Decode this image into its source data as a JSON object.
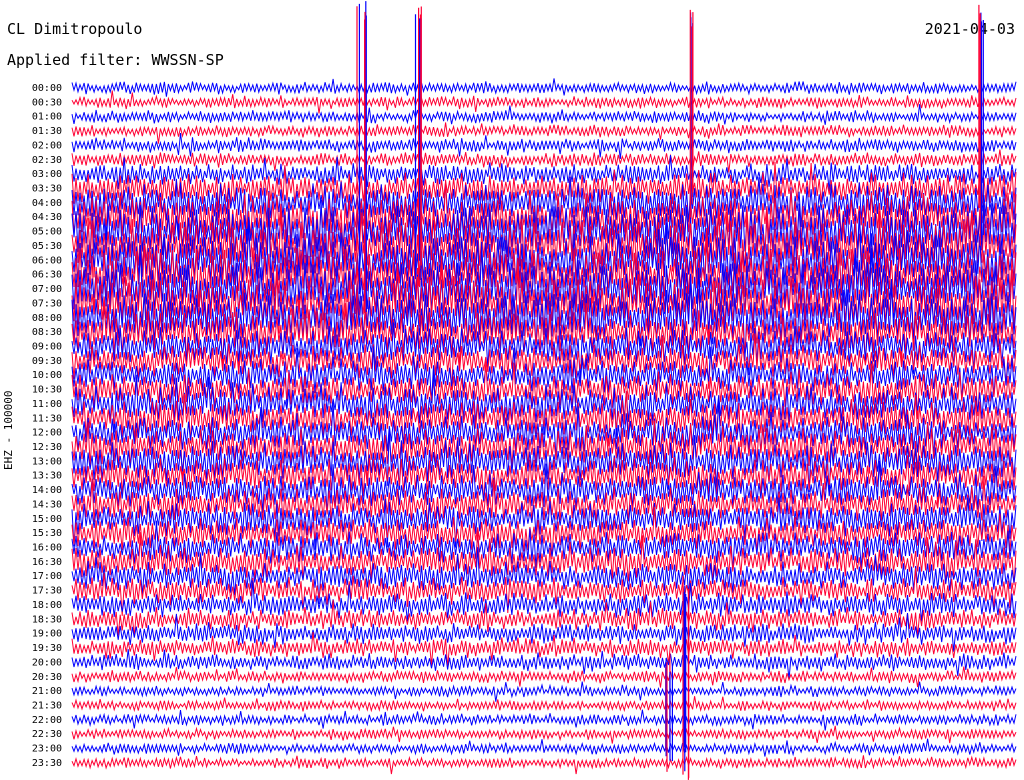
{
  "header": {
    "station": "CL Dimitropoulo",
    "filter": "Applied filter: WWSSN-SP",
    "date": "2021-04-03"
  },
  "channel_label": "EHZ - 100000",
  "chart_data": {
    "type": "line",
    "title": "CL Dimitropoulo",
    "subtitle": "Applied filter: WWSSN-SP",
    "date": "2021-04-03",
    "ylabel": "EHZ - 100000",
    "row_labels": [
      "00:00",
      "00:30",
      "01:00",
      "01:30",
      "02:00",
      "02:30",
      "03:00",
      "03:30",
      "04:00",
      "04:30",
      "05:00",
      "05:30",
      "06:00",
      "06:30",
      "07:00",
      "07:30",
      "08:00",
      "08:30",
      "09:00",
      "09:30",
      "10:00",
      "10:30",
      "11:00",
      "11:30",
      "12:00",
      "12:30",
      "13:00",
      "13:30",
      "14:00",
      "14:30",
      "15:00",
      "15:30",
      "16:00",
      "16:30",
      "17:00",
      "17:30",
      "18:00",
      "18:30",
      "19:00",
      "19:30",
      "20:00",
      "20:30",
      "21:00",
      "21:30",
      "22:00",
      "22:30",
      "23:00",
      "23:30"
    ],
    "row_amplitude": [
      0.15,
      0.15,
      0.15,
      0.15,
      0.2,
      0.2,
      0.35,
      0.55,
      0.75,
      0.9,
      1.0,
      1.0,
      1.0,
      1.0,
      1.0,
      1.0,
      1.0,
      0.8,
      0.65,
      0.6,
      0.6,
      0.6,
      0.65,
      0.65,
      0.65,
      0.7,
      0.7,
      0.65,
      0.6,
      0.6,
      0.6,
      0.6,
      0.55,
      0.55,
      0.5,
      0.45,
      0.4,
      0.35,
      0.35,
      0.3,
      0.25,
      0.15,
      0.12,
      0.12,
      0.12,
      0.12,
      0.12,
      0.12
    ],
    "colors": [
      "#0000ff",
      "#ff0033"
    ],
    "events": [
      {
        "time": "00:00",
        "minute": 9.2,
        "strength": 1.0
      },
      {
        "time": "00:00",
        "minute": 11.0,
        "strength": 0.8
      },
      {
        "time": "00:00",
        "minute": 19.7,
        "strength": 0.5
      },
      {
        "time": "00:00",
        "minute": 28.9,
        "strength": 0.6
      },
      {
        "time": "20:00",
        "minute": 19.5,
        "strength": 0.7
      },
      {
        "time": "23:00",
        "minute": 19.0,
        "strength": 0.9
      }
    ]
  }
}
